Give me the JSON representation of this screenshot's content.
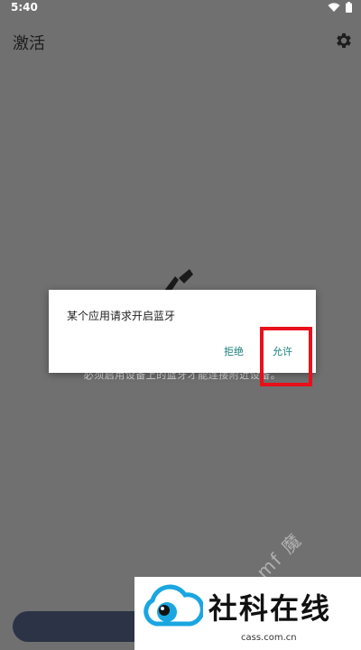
{
  "status_bar": {
    "time": "5:40",
    "icons": [
      "wifi-icon",
      "battery-icon"
    ]
  },
  "app_bar": {
    "title": "激活",
    "settings_icon": "gear-icon"
  },
  "main": {
    "hint": "必须启用设备上的蓝牙才能连接附近设备。"
  },
  "dialog": {
    "message": "某个应用请求开启蓝牙",
    "deny_label": "拒绝",
    "allow_label": "允许"
  },
  "watermark": {
    "text": "mf 魔",
    "logo_text": "社科在线",
    "url": "cass.com.cn"
  },
  "colors": {
    "dialog_button": "#17807a",
    "highlight": "#e8101a",
    "scrim": "#707070"
  }
}
